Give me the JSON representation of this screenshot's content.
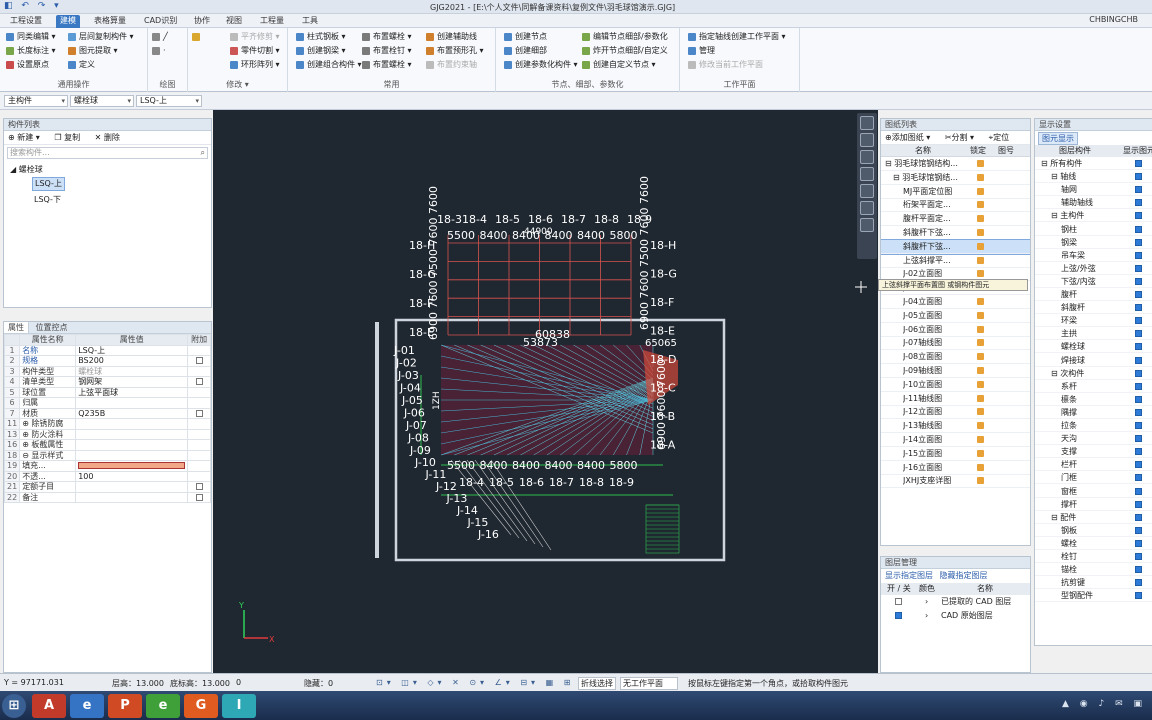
{
  "window": {
    "title": "GJG2021 - [E:\\个人文件\\同解备课资料\\复例文件\\羽毛球馆演示.GJG]",
    "user": "CHBINGCHB"
  },
  "menu": {
    "tabs": [
      "工程设置",
      "建模",
      "表格算量",
      "CAD识别",
      "协作",
      "视图",
      "工程量",
      "工具"
    ],
    "active": "建模"
  },
  "ribbon": {
    "group1": {
      "label": "通用操作",
      "items": [
        "同类编辑 ▾",
        "层间复制构件 ▾",
        "长度标注 ▾",
        "图元提取 ▾",
        "设置原点",
        "定义"
      ]
    },
    "group2": {
      "label": "绘图"
    },
    "group3": {
      "label": "修改 ▾",
      "items": [
        "平齐修剪 ▾",
        "零件切割 ▾",
        "环形阵列 ▾"
      ]
    },
    "group4": {
      "label": "常用",
      "items": [
        "柱式钢板 ▾",
        "创建钢梁 ▾",
        "创建组合构件 ▾",
        "布置螺栓 ▾",
        "布置栓钉 ▾",
        "布置螺栓 ▾",
        "创建辅助线",
        "布置预形孔 ▾",
        "布置约束轴"
      ]
    },
    "group5": {
      "label": "节点、细部、参数化",
      "items": [
        "创建节点",
        "创建细部",
        "创建参数化构件 ▾",
        "编辑节点细部/参数化",
        "炸开节点细部/自定义",
        "创建自定义节点 ▾"
      ]
    },
    "group6": {
      "label": "工作平面",
      "items": [
        "指定轴线创建工作平面 ▾",
        "管理",
        "修改当前工作平面"
      ]
    }
  },
  "selectors": {
    "type": "主构件",
    "sub": "螺栓球",
    "item": "LSQ-上"
  },
  "component_list": {
    "title": "构件列表",
    "buttons": [
      "新建 ▾",
      "复制",
      "删除"
    ],
    "search_placeholder": "搜索构件...",
    "tree_root": "螺栓球",
    "items": [
      "LSQ-上",
      "LSQ-下"
    ]
  },
  "properties": {
    "tabs": [
      "属性",
      "位置控点"
    ],
    "headers": [
      "属性名称",
      "属性值",
      "附加"
    ],
    "rows": [
      {
        "n": "1",
        "name": "名称",
        "value": "LSQ-上",
        "chk": false
      },
      {
        "n": "2",
        "name": "规格",
        "value": "BS200",
        "chk": true
      },
      {
        "n": "3",
        "name": "构件类型",
        "value": "螺栓球",
        "chk": false
      },
      {
        "n": "4",
        "name": "清单类型",
        "value": "钢网架",
        "chk": true
      },
      {
        "n": "5",
        "name": "球位置",
        "value": "上弦平面球",
        "chk": false
      },
      {
        "n": "6",
        "name": "归属",
        "value": "",
        "chk": false
      },
      {
        "n": "7",
        "name": "材质",
        "value": "Q235B",
        "chk": true
      },
      {
        "n": "11",
        "name": "⊕ 除锈防腐",
        "value": "",
        "chk": false
      },
      {
        "n": "13",
        "name": "⊕ 防火涂料",
        "value": "",
        "chk": false
      },
      {
        "n": "16",
        "name": "⊕ 板截属性",
        "value": "",
        "chk": false
      },
      {
        "n": "18",
        "name": "⊖ 显示样式",
        "value": "",
        "chk": false
      },
      {
        "n": "19",
        "name": "填充...",
        "value": "",
        "chk": false
      },
      {
        "n": "20",
        "name": "不透...",
        "value": "100",
        "chk": false
      },
      {
        "n": "21",
        "name": "定额子目",
        "value": "",
        "chk": true
      },
      {
        "n": "22",
        "name": "备注",
        "value": "",
        "chk": true
      }
    ],
    "fill_color": "#f0a888"
  },
  "drawing": {
    "axis_top": [
      "18-3",
      "18-4",
      "18-5",
      "18-6",
      "18-7",
      "18-8",
      "18-9"
    ],
    "axis_bottom": [
      "18-4",
      "18-5",
      "18-6",
      "18-7",
      "18-8",
      "18-9"
    ],
    "dims_top": [
      "5500",
      "8400",
      "8400",
      "8400",
      "8400",
      "5800"
    ],
    "dims_bottom": [
      "5500",
      "8400",
      "8400",
      "8400",
      "8400",
      "5800"
    ],
    "top_total": "44900",
    "rows_left": [
      "18-H",
      "18-G",
      "18-F",
      "18-E"
    ],
    "rows_right": [
      "18-H",
      "18-G",
      "18-F",
      "18-E",
      "18-D",
      "18-C",
      "18-B",
      "18-A"
    ],
    "j_labels": [
      "J-01",
      "J-02",
      "J-03",
      "J-04",
      "J-05",
      "J-06",
      "J-07",
      "J-08",
      "J-09",
      "J-10",
      "J-11",
      "J-12",
      "J-13",
      "J-14",
      "J-15",
      "J-16"
    ],
    "dims_v_left": "6900 7600 7500 7600 7600",
    "dims_v_right": "6900 7600 7500 7600 7600",
    "dims_v_right_lower": "6900 7600 7600",
    "span1": "60838",
    "span2": "53873",
    "span3": "65065",
    "side_dim": "1ZH",
    "axis_x": "X",
    "axis_y": "Y"
  },
  "drawing_list": {
    "title": "图纸列表",
    "buttons": [
      "添加图纸 ▾",
      "分割 ▾",
      "定位"
    ],
    "headers": [
      "名称",
      "锁定",
      "图号"
    ],
    "items": [
      "羽毛球馆钢结构...",
      "羽毛球馆钢结...",
      "MJ平面定位图",
      "桁架平面定...",
      "腹杆平面定...",
      "斜腹杆下弦...",
      "斜腹杆下弦...",
      "上弦斜撑平...",
      "上弦斜撑平面布置图",
      "J-02立面图",
      "J-03立面图",
      "J-04立面图",
      "J-05立面图",
      "J-06立面图",
      "J-07轴线图",
      "J-08立面图",
      "J-09轴线图",
      "J-10立面图",
      "J-11轴线图",
      "J-12立面图",
      "J-13轴线图",
      "J-14立面图",
      "J-15立面图",
      "J-16立面图",
      "JXHJ支座详图"
    ],
    "selected": 6,
    "tooltip": "或钢构件图元"
  },
  "layer_panel": {
    "title": "图层管理",
    "options": [
      "显示指定图层",
      "隐藏指定图层"
    ],
    "headers": [
      "开 / 关",
      "颜色",
      "名称"
    ],
    "rows": [
      {
        "on": false,
        "name": "已提取的 CAD 图层"
      },
      {
        "on": true,
        "name": "CAD 原始图层"
      }
    ]
  },
  "display_settings": {
    "title": "显示设置",
    "tab": "图元显示",
    "headers": [
      "图层构件",
      "显示图元"
    ],
    "rows": [
      {
        "label": "所有构件",
        "lvl": 0,
        "exp": true
      },
      {
        "label": "轴线",
        "lvl": 1,
        "exp": true
      },
      {
        "label": "轴网",
        "lvl": 2
      },
      {
        "label": "辅助轴线",
        "lvl": 2
      },
      {
        "label": "主构件",
        "lvl": 1,
        "exp": true
      },
      {
        "label": "钢柱",
        "lvl": 2
      },
      {
        "label": "钢梁",
        "lvl": 2
      },
      {
        "label": "吊车梁",
        "lvl": 2
      },
      {
        "label": "上弦/外弦",
        "lvl": 2
      },
      {
        "label": "下弦/内弦",
        "lvl": 2
      },
      {
        "label": "腹杆",
        "lvl": 2
      },
      {
        "label": "斜腹杆",
        "lvl": 2
      },
      {
        "label": "环梁",
        "lvl": 2
      },
      {
        "label": "主拱",
        "lvl": 2
      },
      {
        "label": "螺栓球",
        "lvl": 2
      },
      {
        "label": "焊接球",
        "lvl": 2
      },
      {
        "label": "次构件",
        "lvl": 1,
        "exp": true
      },
      {
        "label": "系杆",
        "lvl": 2
      },
      {
        "label": "檩条",
        "lvl": 2
      },
      {
        "label": "隅撑",
        "lvl": 2
      },
      {
        "label": "拉条",
        "lvl": 2
      },
      {
        "label": "天沟",
        "lvl": 2
      },
      {
        "label": "支撑",
        "lvl": 2
      },
      {
        "label": "栏杆",
        "lvl": 2
      },
      {
        "label": "门框",
        "lvl": 2
      },
      {
        "label": "窗框",
        "lvl": 2
      },
      {
        "label": "撑杆",
        "lvl": 2
      },
      {
        "label": "配件",
        "lvl": 1,
        "exp": true
      },
      {
        "label": "钢板",
        "lvl": 2
      },
      {
        "label": "螺栓",
        "lvl": 2
      },
      {
        "label": "栓钉",
        "lvl": 2
      },
      {
        "label": "锚栓",
        "lvl": 2
      },
      {
        "label": "抗剪键",
        "lvl": 2
      },
      {
        "label": "型钢配件",
        "lvl": 2
      }
    ]
  },
  "status": {
    "coord": "Y = 97171.031",
    "floor_h": "层高：13.000",
    "base_h": "底标高：13.000",
    "zero": "0",
    "hidden": "隐藏：0",
    "select_mode": "折线选择",
    "workplane": "无工作平面",
    "hint": "按鼠标左键指定第一个角点，或拾取构件图元"
  },
  "taskbar": {
    "apps": [
      "e",
      "A",
      "P",
      "e",
      "G",
      "I"
    ]
  }
}
